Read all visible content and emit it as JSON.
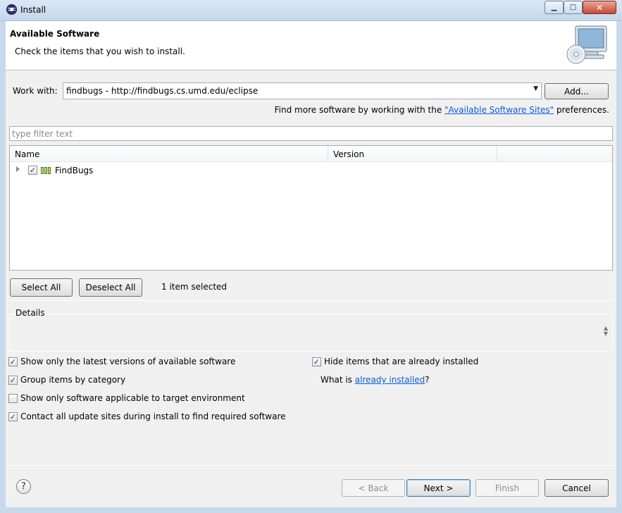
{
  "window": {
    "title": "Install",
    "minimize_glyph": "▁",
    "maximize_glyph": "□",
    "close_glyph": "✕"
  },
  "header": {
    "title": "Available Software",
    "subtitle": "Check the items that you wish to install."
  },
  "work_with": {
    "label": "Work with:",
    "value": "findbugs - http://findbugs.cs.umd.edu/eclipse",
    "add_label": "Add..."
  },
  "find_more": {
    "prefix": "Find more software by working with the ",
    "link": "\"Available Software Sites\"",
    "suffix": " preferences."
  },
  "filter": {
    "placeholder": "type filter text",
    "value": ""
  },
  "tree": {
    "columns": [
      "Name",
      "Version"
    ],
    "rows": [
      {
        "name": "FindBugs",
        "version": "",
        "checked": true
      }
    ]
  },
  "selection": {
    "select_all_label": "Select All",
    "deselect_all_label": "Deselect All",
    "count_text": "1 item selected"
  },
  "details": {
    "label": "Details",
    "text": ""
  },
  "options": {
    "latest_versions": {
      "label": "Show only the latest versions of available software",
      "checked": true
    },
    "group_by_category": {
      "label": "Group items by category",
      "checked": true
    },
    "applicable_only": {
      "label": "Show only software applicable to target environment",
      "checked": false
    },
    "contact_update_sites": {
      "label": "Contact all update sites during install to find required software",
      "checked": true
    },
    "hide_installed": {
      "label": "Hide items that are already installed",
      "checked": true
    }
  },
  "what_is": {
    "prefix": "What is ",
    "link": "already installed",
    "suffix": "?"
  },
  "footer": {
    "help_glyph": "?",
    "back_label": "< Back",
    "next_label": "Next >",
    "finish_label": "Finish",
    "cancel_label": "Cancel"
  },
  "checkmark_glyph": "✓",
  "icons": [
    "eclipse-icon",
    "monitor-cd-icon",
    "package-icon",
    "expand-arrow-icon",
    "help-icon",
    "dropdown-arrow-icon"
  ]
}
